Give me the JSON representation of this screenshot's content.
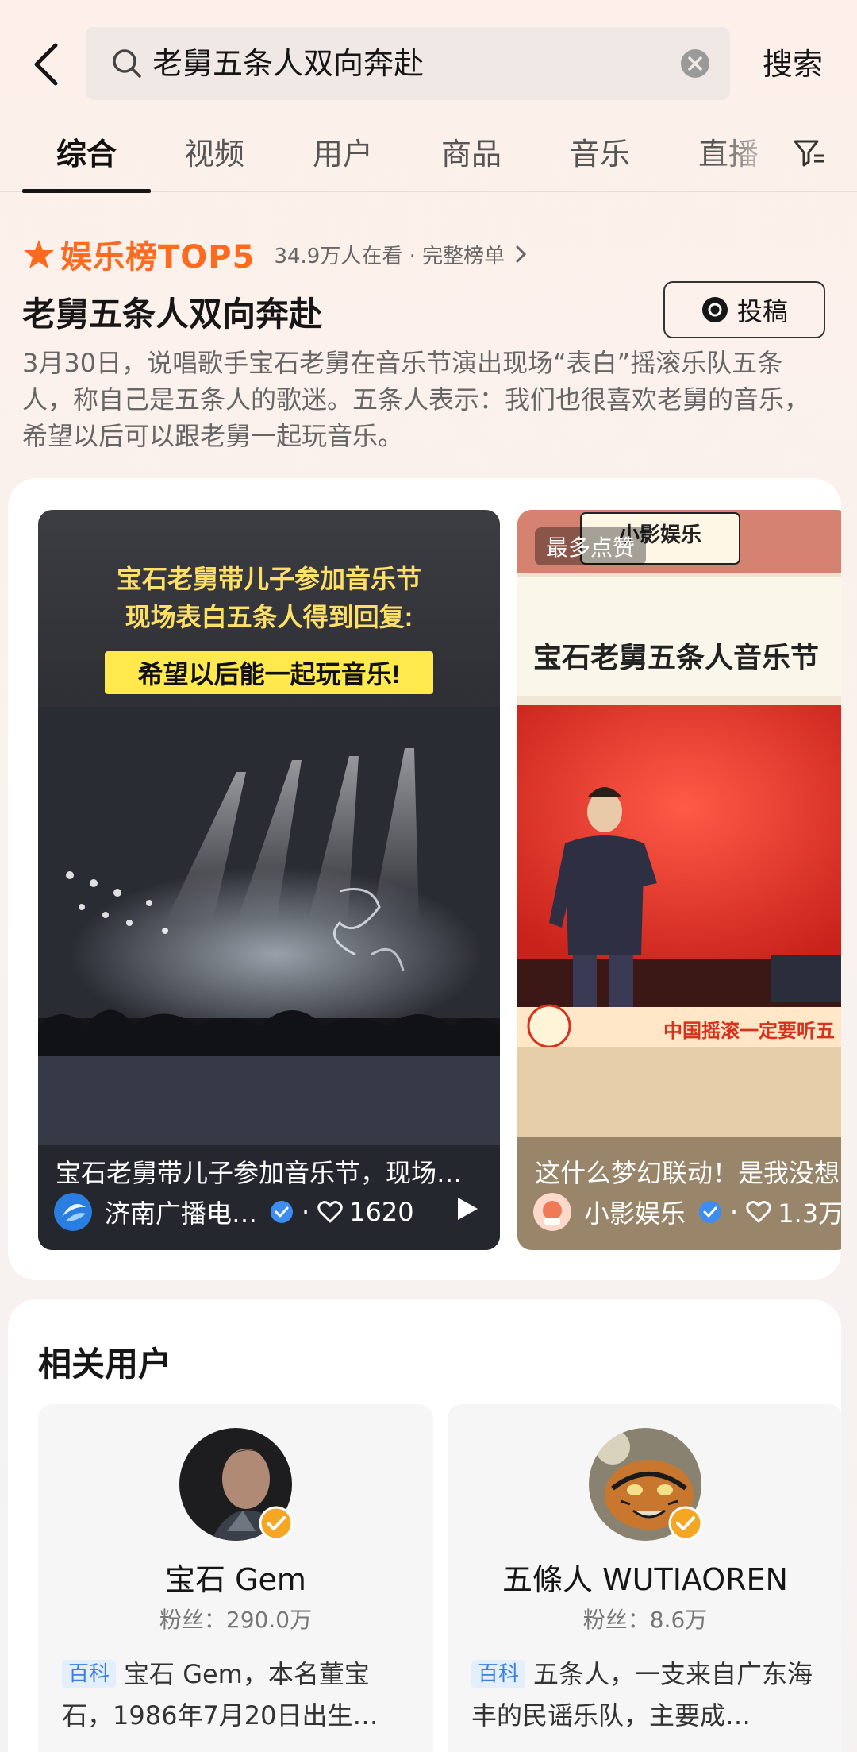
{
  "search": {
    "query": "老舅五条人双向奔赴",
    "button_label": "搜索"
  },
  "tabs": [
    {
      "label": "综合",
      "active": true
    },
    {
      "label": "视频",
      "active": false
    },
    {
      "label": "用户",
      "active": false
    },
    {
      "label": "商品",
      "active": false
    },
    {
      "label": "音乐",
      "active": false
    },
    {
      "label": "直播",
      "active": false
    }
  ],
  "trending": {
    "badge": "娱乐榜TOP5",
    "meta": "34.9万人在看 · 完整榜单",
    "title": "老舅五条人双向奔赴",
    "post_label": "投稿",
    "description": "3月30日，说唱歌手宝石老舅在音乐节演出现场“表白”摇滚乐队五条人，称自己是五条人的歌迷。五条人表示：我们也很喜欢老舅的音乐，希望以后可以跟老舅一起玩音乐。",
    "accent_color": "#ff6a1f"
  },
  "videos": [
    {
      "caption_lines": [
        "宝石老舅带儿子参加音乐节",
        "现场表白五条人得到回复:",
        "希望以后能一起玩音乐!"
      ],
      "title": "宝石老舅带儿子参加音乐节，现场…",
      "author": "济南广播电…",
      "likes": "1620"
    },
    {
      "badge": "最多点赞",
      "watermark": "小影娱乐",
      "caption": "宝石老舅五条人音乐节",
      "banner": "中国摇滚一定要听五",
      "title": "这什么梦幻联动！是我没想",
      "author": "小影娱乐",
      "likes": "1.3万"
    }
  ],
  "related_users": {
    "title": "相关用户",
    "users": [
      {
        "name": "宝石 Gem",
        "fans": "粉丝：290.0万",
        "tag": "百科",
        "desc": "宝石 Gem，本名董宝石，1986年7月20日出生…"
      },
      {
        "name": "五條人 WUTIAOREN",
        "fans": "粉丝：8.6万",
        "tag": "百科",
        "desc": "五条人，一支来自广东海丰的民谣乐队，主要成…"
      }
    ]
  },
  "colors": {
    "verified": "#3d8cf0",
    "verified_gold": "#f5a623"
  }
}
